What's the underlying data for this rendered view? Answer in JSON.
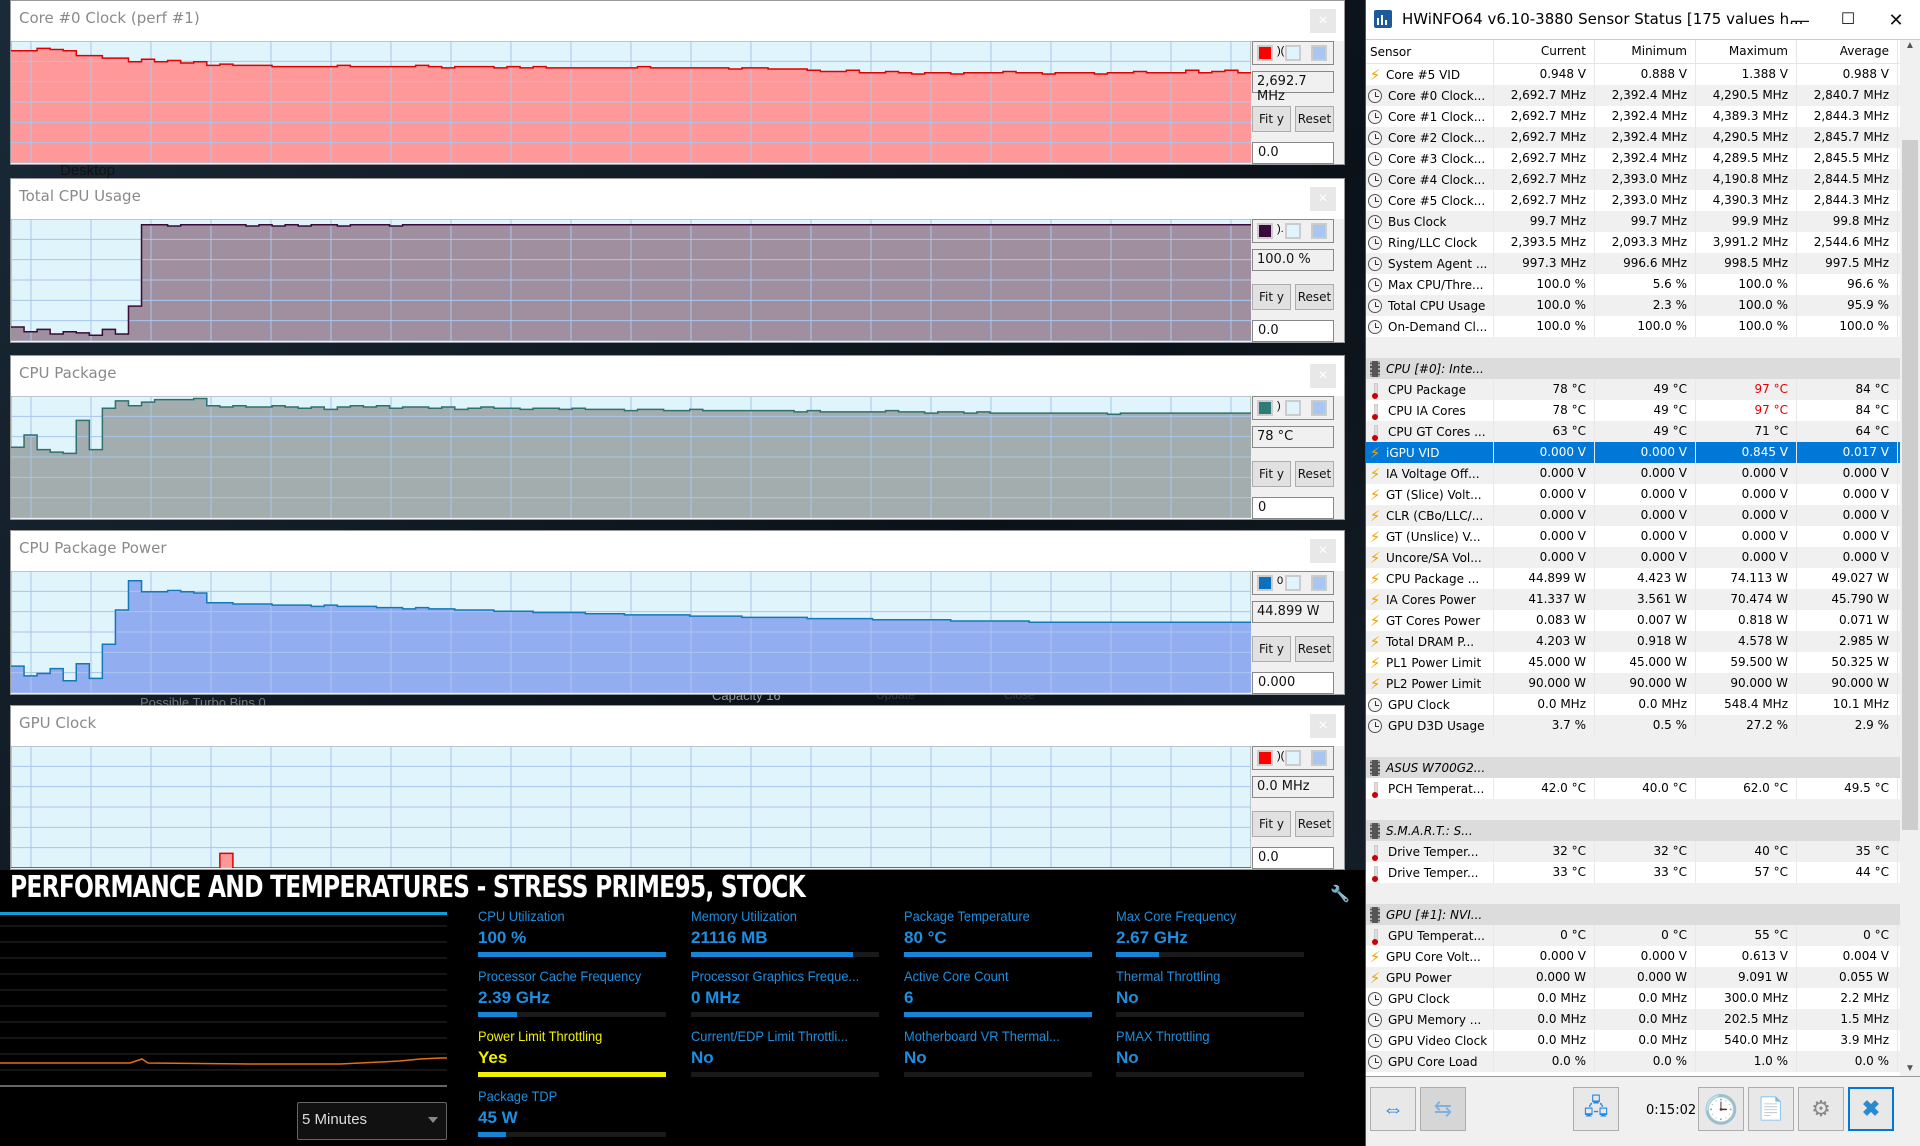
{
  "background": {
    "desktop_label": "Desktop",
    "turbo_bins": "Possible Turbo Bins  0",
    "capacity_label": "Capacity  16",
    "update_label": "Update",
    "close_label": "Close"
  },
  "graphs": [
    {
      "title": "Core #0 Clock (perf #1)",
      "current": "2,692.7 MHz",
      "min": "0.0",
      "fit_label": "Fit y",
      "reset_label": "Reset",
      "line_color": "#e00000",
      "fill_color": "#ff9999",
      "swatch": "#ff0000",
      "swatch_text": ")(",
      "series": [
        92,
        92,
        94,
        93,
        92,
        88,
        88,
        86,
        86,
        83,
        85,
        83,
        84,
        82,
        83,
        80,
        81,
        80,
        80,
        80,
        79,
        79,
        79,
        79,
        79,
        80,
        79,
        79,
        79,
        79,
        79,
        80,
        79,
        78,
        79,
        79,
        79,
        78,
        79,
        78,
        79,
        78,
        78,
        78,
        78,
        78,
        78,
        78,
        79,
        78,
        78,
        78,
        78,
        78,
        78,
        77,
        78,
        78,
        77,
        77,
        77,
        76,
        75,
        75,
        76,
        74,
        74,
        75,
        74,
        73,
        74,
        74,
        73,
        74,
        74,
        74,
        75,
        74,
        74,
        73,
        74,
        74,
        74,
        73,
        74,
        74,
        75,
        74,
        74,
        74,
        76,
        74,
        75,
        76,
        74
      ],
      "ymax": 100
    },
    {
      "title": "Total CPU Usage",
      "current": "100.0 %",
      "min": "0.0",
      "fit_label": "Fit y",
      "reset_label": "Reset",
      "line_color": "#3b0a3a",
      "fill_color": "#a0909f",
      "swatch": "#3b0a3a",
      "swatch_text": ").",
      "series": [
        12,
        8,
        10,
        6,
        8,
        7,
        5,
        10,
        6,
        30,
        100,
        100,
        99,
        100,
        100,
        100,
        100,
        100,
        99,
        100,
        99,
        100,
        99,
        100,
        100,
        99,
        100,
        100,
        100,
        99,
        100,
        100,
        100,
        100,
        100,
        100,
        100,
        100,
        100,
        100,
        100,
        100,
        100,
        100,
        100,
        100,
        100,
        100,
        100,
        100,
        100,
        100,
        100,
        100,
        100,
        100,
        100,
        100,
        100,
        100,
        100,
        100,
        100,
        100,
        100,
        100,
        100,
        100,
        100,
        100,
        100,
        100,
        100,
        100,
        100,
        100,
        100,
        100,
        100,
        100,
        100,
        100,
        100,
        100,
        100,
        100,
        100,
        100,
        100,
        100,
        100,
        100,
        100,
        100,
        100
      ],
      "ymax": 105
    },
    {
      "title": "CPU Package",
      "current": "78 °C",
      "min": "0",
      "fit_label": "Fit y",
      "reset_label": "Reset",
      "line_color": "#2f7070",
      "fill_color": "#a4adad",
      "swatch": "#2f7b78",
      "swatch_text": ")",
      "series": [
        58,
        68,
        56,
        54,
        53,
        80,
        56,
        90,
        96,
        92,
        95,
        97,
        97,
        97,
        98,
        92,
        91,
        92,
        91,
        91,
        92,
        91,
        90,
        91,
        89,
        91,
        92,
        91,
        92,
        90,
        91,
        91,
        90,
        91,
        89,
        90,
        91,
        90,
        90,
        89,
        90,
        90,
        89,
        90,
        89,
        89,
        89,
        88,
        89,
        89,
        88,
        88,
        89,
        88,
        88,
        88,
        88,
        88,
        88,
        88,
        87,
        88,
        87,
        87,
        87,
        87,
        87,
        88,
        87,
        87,
        86,
        87,
        87,
        86,
        87,
        86,
        86,
        86,
        86,
        86,
        86,
        86,
        86,
        86,
        85,
        86,
        86,
        86,
        86,
        86,
        86,
        86,
        86,
        86,
        86
      ],
      "ymax": 100
    },
    {
      "title": "CPU Package Power",
      "current": "44.899 W",
      "min": "0.000",
      "fit_label": "Fit y",
      "reset_label": "Reset",
      "line_color": "#1478b8",
      "fill_color": "#93aef0",
      "swatch": "#0a70c0",
      "swatch_text": "0",
      "series": [
        22,
        14,
        16,
        20,
        10,
        24,
        12,
        40,
        68,
        92,
        83,
        83,
        84,
        83,
        82,
        74,
        74,
        73,
        73,
        73,
        72,
        72,
        72,
        71,
        72,
        71,
        71,
        71,
        70,
        70,
        69,
        70,
        69,
        69,
        68,
        68,
        68,
        67,
        67,
        67,
        66,
        66,
        66,
        66,
        65,
        65,
        65,
        64,
        64,
        64,
        64,
        64,
        63,
        63,
        63,
        63,
        62,
        62,
        62,
        62,
        62,
        61,
        61,
        61,
        61,
        61,
        60,
        60,
        60,
        60,
        60,
        60,
        59,
        59,
        59,
        59,
        59,
        59,
        58,
        58,
        58,
        58,
        58,
        58,
        58,
        58,
        58,
        58,
        58,
        58,
        58,
        58,
        58,
        58,
        58
      ],
      "ymax": 100
    },
    {
      "title": "GPU Clock",
      "current": "0.0 MHz",
      "min": "0.0",
      "fit_label": "Fit y",
      "reset_label": "Reset",
      "line_color": "#e00000",
      "fill_color": "#ff9999",
      "swatch": "#ff0000",
      "swatch_text": ")(",
      "series": [
        0,
        0,
        0,
        0,
        0,
        0,
        0,
        0,
        0,
        0,
        0,
        0,
        0,
        0,
        0,
        0,
        12,
        0,
        0,
        0,
        0,
        0,
        0,
        0,
        0,
        0,
        0,
        0,
        0,
        0,
        0,
        0,
        0,
        0,
        0,
        0,
        0,
        0,
        0,
        0,
        0,
        0,
        0,
        0,
        0,
        0,
        0,
        0,
        0,
        0,
        0,
        0,
        0,
        0,
        0,
        0,
        0,
        0,
        0,
        0,
        0,
        0,
        0,
        0,
        0,
        0,
        0,
        0,
        0,
        0,
        0,
        0,
        0,
        0,
        0,
        0,
        0,
        0,
        0,
        0,
        0,
        0,
        0,
        0,
        0,
        0,
        0,
        0,
        0,
        0,
        0,
        0,
        0,
        0,
        0
      ],
      "ymax": 100
    }
  ],
  "hwinfo": {
    "title": "HWiNFO64 v6.10-3880 Sensor Status [175 values h...",
    "columns": [
      "Sensor",
      "Current",
      "Minimum",
      "Maximum",
      "Average"
    ],
    "rows": [
      {
        "icon": "bolt",
        "name": "Core #5 VID",
        "cur": "0.948 V",
        "min": "0.888 V",
        "max": "1.388 V",
        "avg": "0.988 V"
      },
      {
        "icon": "clock",
        "name": "Core #0 Clock...",
        "cur": "2,692.7 MHz",
        "min": "2,392.4 MHz",
        "max": "4,290.5 MHz",
        "avg": "2,840.7 MHz"
      },
      {
        "icon": "clock",
        "name": "Core #1 Clock...",
        "cur": "2,692.7 MHz",
        "min": "2,392.4 MHz",
        "max": "4,389.3 MHz",
        "avg": "2,844.3 MHz"
      },
      {
        "icon": "clock",
        "name": "Core #2 Clock...",
        "cur": "2,692.7 MHz",
        "min": "2,392.4 MHz",
        "max": "4,290.5 MHz",
        "avg": "2,845.7 MHz"
      },
      {
        "icon": "clock",
        "name": "Core #3 Clock...",
        "cur": "2,692.7 MHz",
        "min": "2,392.4 MHz",
        "max": "4,289.5 MHz",
        "avg": "2,845.5 MHz"
      },
      {
        "icon": "clock",
        "name": "Core #4 Clock...",
        "cur": "2,692.7 MHz",
        "min": "2,393.0 MHz",
        "max": "4,190.8 MHz",
        "avg": "2,844.5 MHz"
      },
      {
        "icon": "clock",
        "name": "Core #5 Clock...",
        "cur": "2,692.7 MHz",
        "min": "2,393.0 MHz",
        "max": "4,390.3 MHz",
        "avg": "2,844.3 MHz"
      },
      {
        "icon": "clock",
        "name": "Bus Clock",
        "cur": "99.7 MHz",
        "min": "99.7 MHz",
        "max": "99.9 MHz",
        "avg": "99.8 MHz"
      },
      {
        "icon": "clock",
        "name": "Ring/LLC Clock",
        "cur": "2,393.5 MHz",
        "min": "2,093.3 MHz",
        "max": "3,991.2 MHz",
        "avg": "2,544.6 MHz"
      },
      {
        "icon": "clock",
        "name": "System Agent ...",
        "cur": "997.3 MHz",
        "min": "996.6 MHz",
        "max": "998.5 MHz",
        "avg": "997.5 MHz"
      },
      {
        "icon": "clock",
        "name": "Max CPU/Thre...",
        "cur": "100.0 %",
        "min": "5.6 %",
        "max": "100.0 %",
        "avg": "96.6 %"
      },
      {
        "icon": "clock",
        "name": "Total CPU Usage",
        "cur": "100.0 %",
        "min": "2.3 %",
        "max": "100.0 %",
        "avg": "95.9 %"
      },
      {
        "icon": "clock",
        "name": "On-Demand Cl...",
        "cur": "100.0 %",
        "min": "100.0 %",
        "max": "100.0 %",
        "avg": "100.0 %"
      },
      {
        "type": "blank"
      },
      {
        "type": "group",
        "icon": "chip",
        "name": "CPU [#0]: Inte..."
      },
      {
        "icon": "therm",
        "name": "CPU Package",
        "cur": "78 °C",
        "min": "49 °C",
        "max": "97 °C",
        "avg": "84 °C",
        "max_alert": true
      },
      {
        "icon": "therm",
        "name": "CPU IA Cores",
        "cur": "78 °C",
        "min": "49 °C",
        "max": "97 °C",
        "avg": "84 °C",
        "max_alert": true
      },
      {
        "icon": "therm",
        "name": "CPU GT Cores ...",
        "cur": "63 °C",
        "min": "49 °C",
        "max": "71 °C",
        "avg": "64 °C"
      },
      {
        "icon": "bolt",
        "name": "iGPU VID",
        "cur": "0.000 V",
        "min": "0.000 V",
        "max": "0.845 V",
        "avg": "0.017 V",
        "selected": true
      },
      {
        "icon": "bolt",
        "name": "IA Voltage Off...",
        "cur": "0.000 V",
        "min": "0.000 V",
        "max": "0.000 V",
        "avg": "0.000 V"
      },
      {
        "icon": "bolt",
        "name": "GT (Slice) Volt...",
        "cur": "0.000 V",
        "min": "0.000 V",
        "max": "0.000 V",
        "avg": "0.000 V"
      },
      {
        "icon": "bolt",
        "name": "CLR (CBo/LLC/...",
        "cur": "0.000 V",
        "min": "0.000 V",
        "max": "0.000 V",
        "avg": "0.000 V"
      },
      {
        "icon": "bolt",
        "name": "GT (Unslice) V...",
        "cur": "0.000 V",
        "min": "0.000 V",
        "max": "0.000 V",
        "avg": "0.000 V"
      },
      {
        "icon": "bolt",
        "name": "Uncore/SA Vol...",
        "cur": "0.000 V",
        "min": "0.000 V",
        "max": "0.000 V",
        "avg": "0.000 V"
      },
      {
        "icon": "bolt",
        "name": "CPU Package ...",
        "cur": "44.899 W",
        "min": "4.423 W",
        "max": "74.113 W",
        "avg": "49.027 W"
      },
      {
        "icon": "bolt",
        "name": "IA Cores Power",
        "cur": "41.337 W",
        "min": "3.561 W",
        "max": "70.474 W",
        "avg": "45.790 W"
      },
      {
        "icon": "bolt",
        "name": "GT Cores Power",
        "cur": "0.083 W",
        "min": "0.007 W",
        "max": "0.818 W",
        "avg": "0.071 W"
      },
      {
        "icon": "bolt",
        "name": "Total DRAM P...",
        "cur": "4.203 W",
        "min": "0.918 W",
        "max": "4.578 W",
        "avg": "2.985 W"
      },
      {
        "icon": "bolt",
        "name": "PL1 Power Limit",
        "cur": "45.000 W",
        "min": "45.000 W",
        "max": "59.500 W",
        "avg": "50.325 W"
      },
      {
        "icon": "bolt",
        "name": "PL2 Power Limit",
        "cur": "90.000 W",
        "min": "90.000 W",
        "max": "90.000 W",
        "avg": "90.000 W"
      },
      {
        "icon": "clock",
        "name": "GPU Clock",
        "cur": "0.0 MHz",
        "min": "0.0 MHz",
        "max": "548.4 MHz",
        "avg": "10.1 MHz"
      },
      {
        "icon": "clock",
        "name": "GPU D3D Usage",
        "cur": "3.7 %",
        "min": "0.5 %",
        "max": "27.2 %",
        "avg": "2.9 %"
      },
      {
        "type": "blank"
      },
      {
        "type": "group",
        "icon": "chip",
        "name": "ASUS W700G2..."
      },
      {
        "icon": "therm",
        "name": "PCH Temperat...",
        "cur": "42.0 °C",
        "min": "40.0 °C",
        "max": "62.0 °C",
        "avg": "49.5 °C"
      },
      {
        "type": "blank"
      },
      {
        "type": "group",
        "icon": "chip",
        "name": "S.M.A.R.T.: S..."
      },
      {
        "icon": "therm",
        "name": "Drive Temper...",
        "cur": "32 °C",
        "min": "32 °C",
        "max": "40 °C",
        "avg": "35 °C"
      },
      {
        "icon": "therm",
        "name": "Drive Temper...",
        "cur": "33 °C",
        "min": "33 °C",
        "max": "57 °C",
        "avg": "44 °C"
      },
      {
        "type": "blank"
      },
      {
        "type": "group",
        "icon": "chip",
        "name": "GPU [#1]: NVI..."
      },
      {
        "icon": "therm",
        "name": "GPU Temperat...",
        "cur": "0 °C",
        "min": "0 °C",
        "max": "55 °C",
        "avg": "0 °C"
      },
      {
        "icon": "bolt",
        "name": "GPU Core Volt...",
        "cur": "0.000 V",
        "min": "0.000 V",
        "max": "0.613 V",
        "avg": "0.004 V"
      },
      {
        "icon": "bolt",
        "name": "GPU Power",
        "cur": "0.000 W",
        "min": "0.000 W",
        "max": "9.091 W",
        "avg": "0.055 W"
      },
      {
        "icon": "clock",
        "name": "GPU Clock",
        "cur": "0.0 MHz",
        "min": "0.0 MHz",
        "max": "300.0 MHz",
        "avg": "2.2 MHz"
      },
      {
        "icon": "clock",
        "name": "GPU Memory ...",
        "cur": "0.0 MHz",
        "min": "0.0 MHz",
        "max": "202.5 MHz",
        "avg": "1.5 MHz"
      },
      {
        "icon": "clock",
        "name": "GPU Video Clock",
        "cur": "0.0 MHz",
        "min": "0.0 MHz",
        "max": "540.0 MHz",
        "avg": "3.9 MHz"
      },
      {
        "icon": "clock",
        "name": "GPU Core Load",
        "cur": "0.0 %",
        "min": "0.0 %",
        "max": "1.0 %",
        "avg": "0.0 %"
      }
    ],
    "elapsed": "0:15:02"
  },
  "xtu": {
    "heading": "PERFORMANCE AND TEMPERATURES - STRESS PRIME95, STOCK",
    "range_select": "5 Minutes",
    "metrics": [
      {
        "label": "CPU Utilization",
        "value": "100 %",
        "fill": 1.0
      },
      {
        "label": "Memory Utilization",
        "value": "21116  MB",
        "fill": 0.86
      },
      {
        "label": "Package Temperature",
        "value": "80 °C",
        "fill": 1.0
      },
      {
        "label": "Max Core Frequency",
        "value": "2.67 GHz",
        "fill": 0.23
      },
      {
        "label": "Processor Cache Frequency",
        "value": "2.39 GHz",
        "fill": 0.21
      },
      {
        "label": "Processor Graphics Freque...",
        "value": "0 MHz",
        "fill": 0
      },
      {
        "label": "Active Core Count",
        "value": "6",
        "fill": 1.0
      },
      {
        "label": "Thermal Throttling",
        "value": "No",
        "fill": 0
      },
      {
        "label": "Power Limit Throttling",
        "value": "Yes",
        "fill": 1.0,
        "alert": true
      },
      {
        "label": "Current/EDP Limit Throttli...",
        "value": "No",
        "fill": 0
      },
      {
        "label": "Motherboard VR Thermal...",
        "value": "No",
        "fill": 0
      },
      {
        "label": "PMAX Throttling",
        "value": "No",
        "fill": 0
      },
      {
        "label": "Package TDP",
        "value": "45 W",
        "fill": 0.15
      }
    ]
  }
}
